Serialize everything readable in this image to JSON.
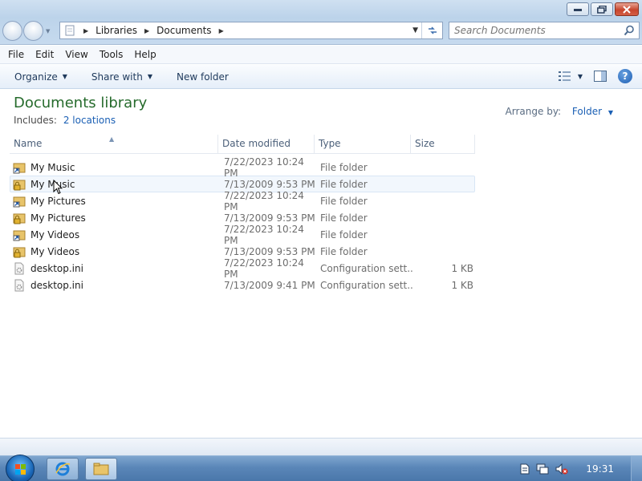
{
  "window": {
    "controls": {
      "minimize": "minimize",
      "maximize": "restore",
      "close": "close"
    }
  },
  "address": {
    "breadcrumbs": [
      "Libraries",
      "Documents"
    ]
  },
  "search": {
    "placeholder": "Search Documents"
  },
  "menu": {
    "file": "File",
    "edit": "Edit",
    "view": "View",
    "tools": "Tools",
    "help": "Help"
  },
  "toolbar": {
    "organize": "Organize",
    "share_with": "Share with",
    "new_folder": "New folder"
  },
  "library": {
    "title": "Documents library",
    "includes_label": "Includes:",
    "locations_link": "2 locations",
    "arrange_label": "Arrange by:",
    "arrange_value": "Folder"
  },
  "columns": {
    "name": "Name",
    "date": "Date modified",
    "type": "Type",
    "size": "Size"
  },
  "files": [
    {
      "name": "My Music",
      "date": "7/22/2023 10:24 PM",
      "type": "File folder",
      "size": "",
      "icon": "shortcut-folder-icon"
    },
    {
      "name": "My Music",
      "date": "7/13/2009 9:53 PM",
      "type": "File folder",
      "size": "",
      "icon": "locked-folder-icon"
    },
    {
      "name": "My Pictures",
      "date": "7/22/2023 10:24 PM",
      "type": "File folder",
      "size": "",
      "icon": "shortcut-folder-icon"
    },
    {
      "name": "My Pictures",
      "date": "7/13/2009 9:53 PM",
      "type": "File folder",
      "size": "",
      "icon": "locked-folder-icon"
    },
    {
      "name": "My Videos",
      "date": "7/22/2023 10:24 PM",
      "type": "File folder",
      "size": "",
      "icon": "shortcut-folder-icon"
    },
    {
      "name": "My Videos",
      "date": "7/13/2009 9:53 PM",
      "type": "File folder",
      "size": "",
      "icon": "locked-folder-icon"
    },
    {
      "name": "desktop.ini",
      "date": "7/22/2023 10:24 PM",
      "type": "Configuration sett...",
      "size": "1 KB",
      "icon": "settings-file-icon"
    },
    {
      "name": "desktop.ini",
      "date": "7/13/2009 9:41 PM",
      "type": "Configuration sett...",
      "size": "1 KB",
      "icon": "settings-file-icon"
    }
  ],
  "taskbar": {
    "clock": "19:31"
  }
}
